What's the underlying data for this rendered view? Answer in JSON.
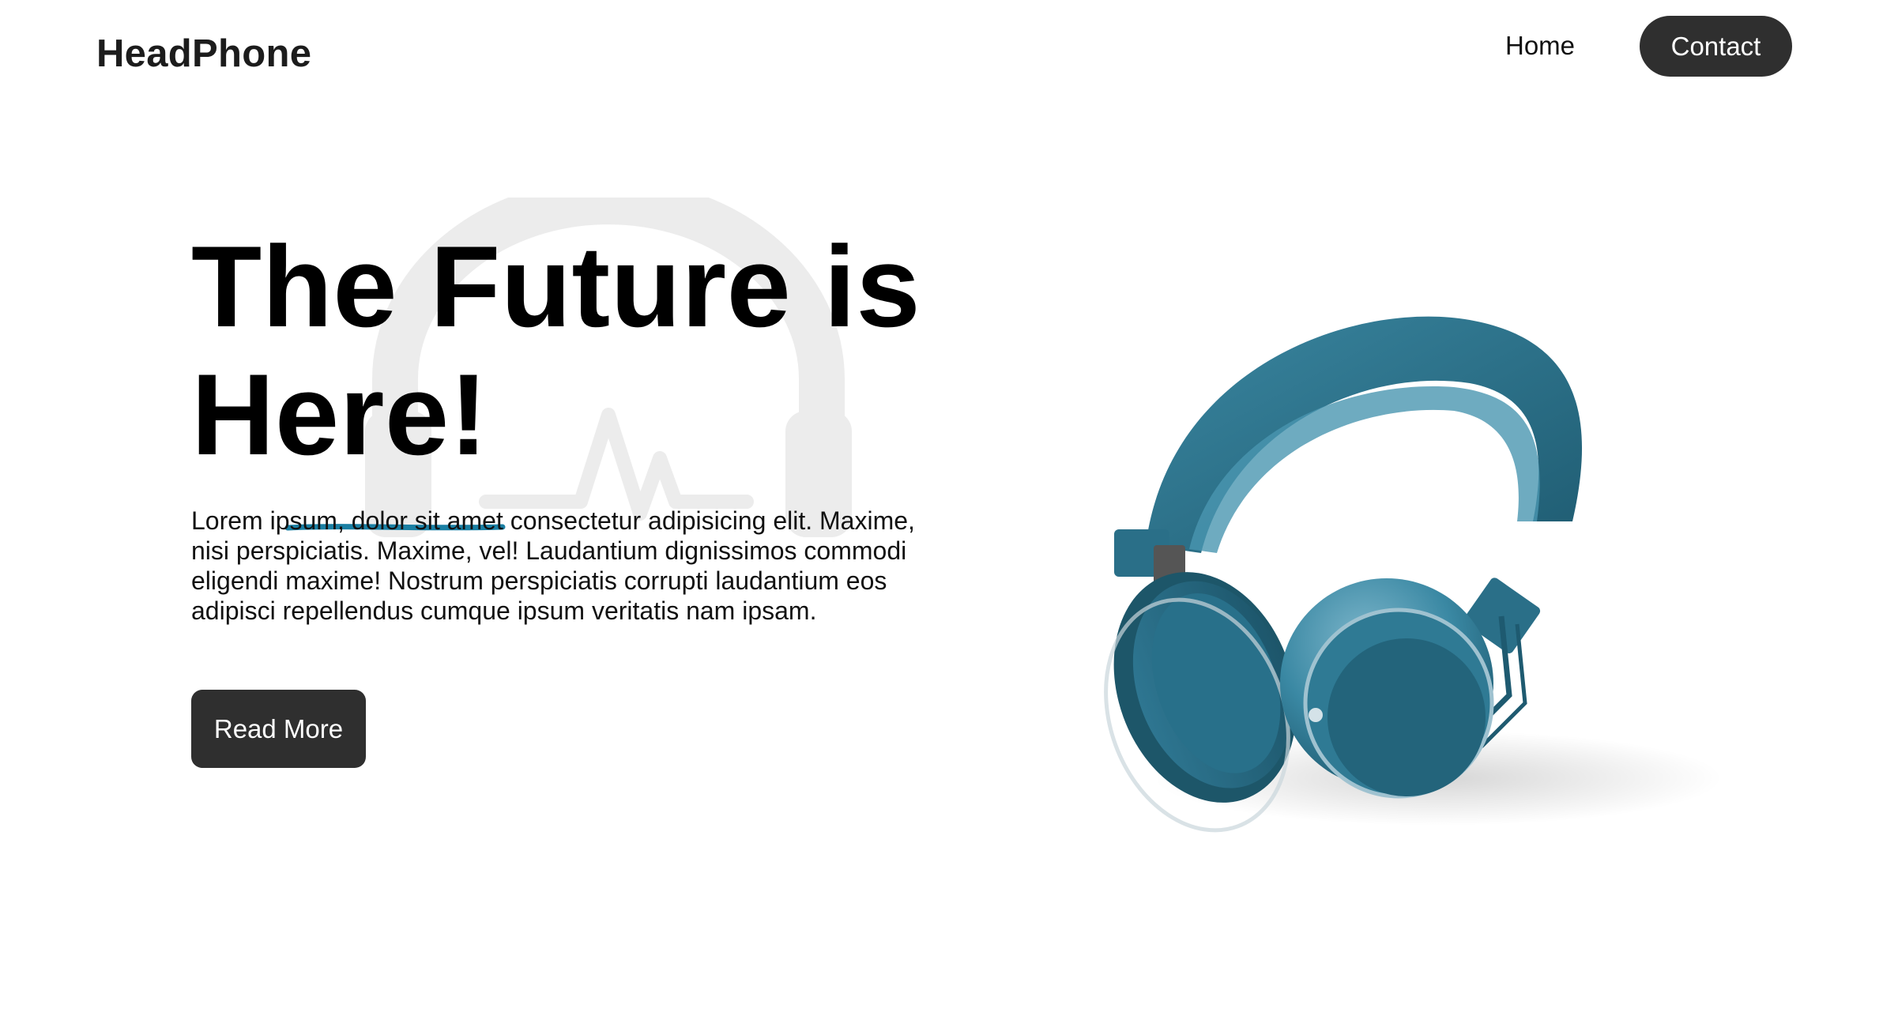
{
  "nav": {
    "brand": "HeadPhone",
    "home_label": "Home",
    "contact_label": "Contact"
  },
  "hero": {
    "title": "The Future is Here!",
    "body": "Lorem ipsum, dolor sit amet consectetur adipisicing elit. Maxime, nisi perspiciatis. Maxime, vel! Laudantium dignissimos commodi eligendi maxime! Nostrum perspiciatis corrupti laudantium eos adipisci repellendus cumque ipsum veritatis nam ipsam.",
    "cta_label": "Read More"
  },
  "colors": {
    "button_bg": "#2f2f2f",
    "headphone_teal": "#2b6f86",
    "accent_line": "#1a7fa3",
    "bg_logo": "#ececec"
  },
  "icons": {
    "background": "headphone-pulse-icon",
    "product": "headphone-product-image"
  }
}
